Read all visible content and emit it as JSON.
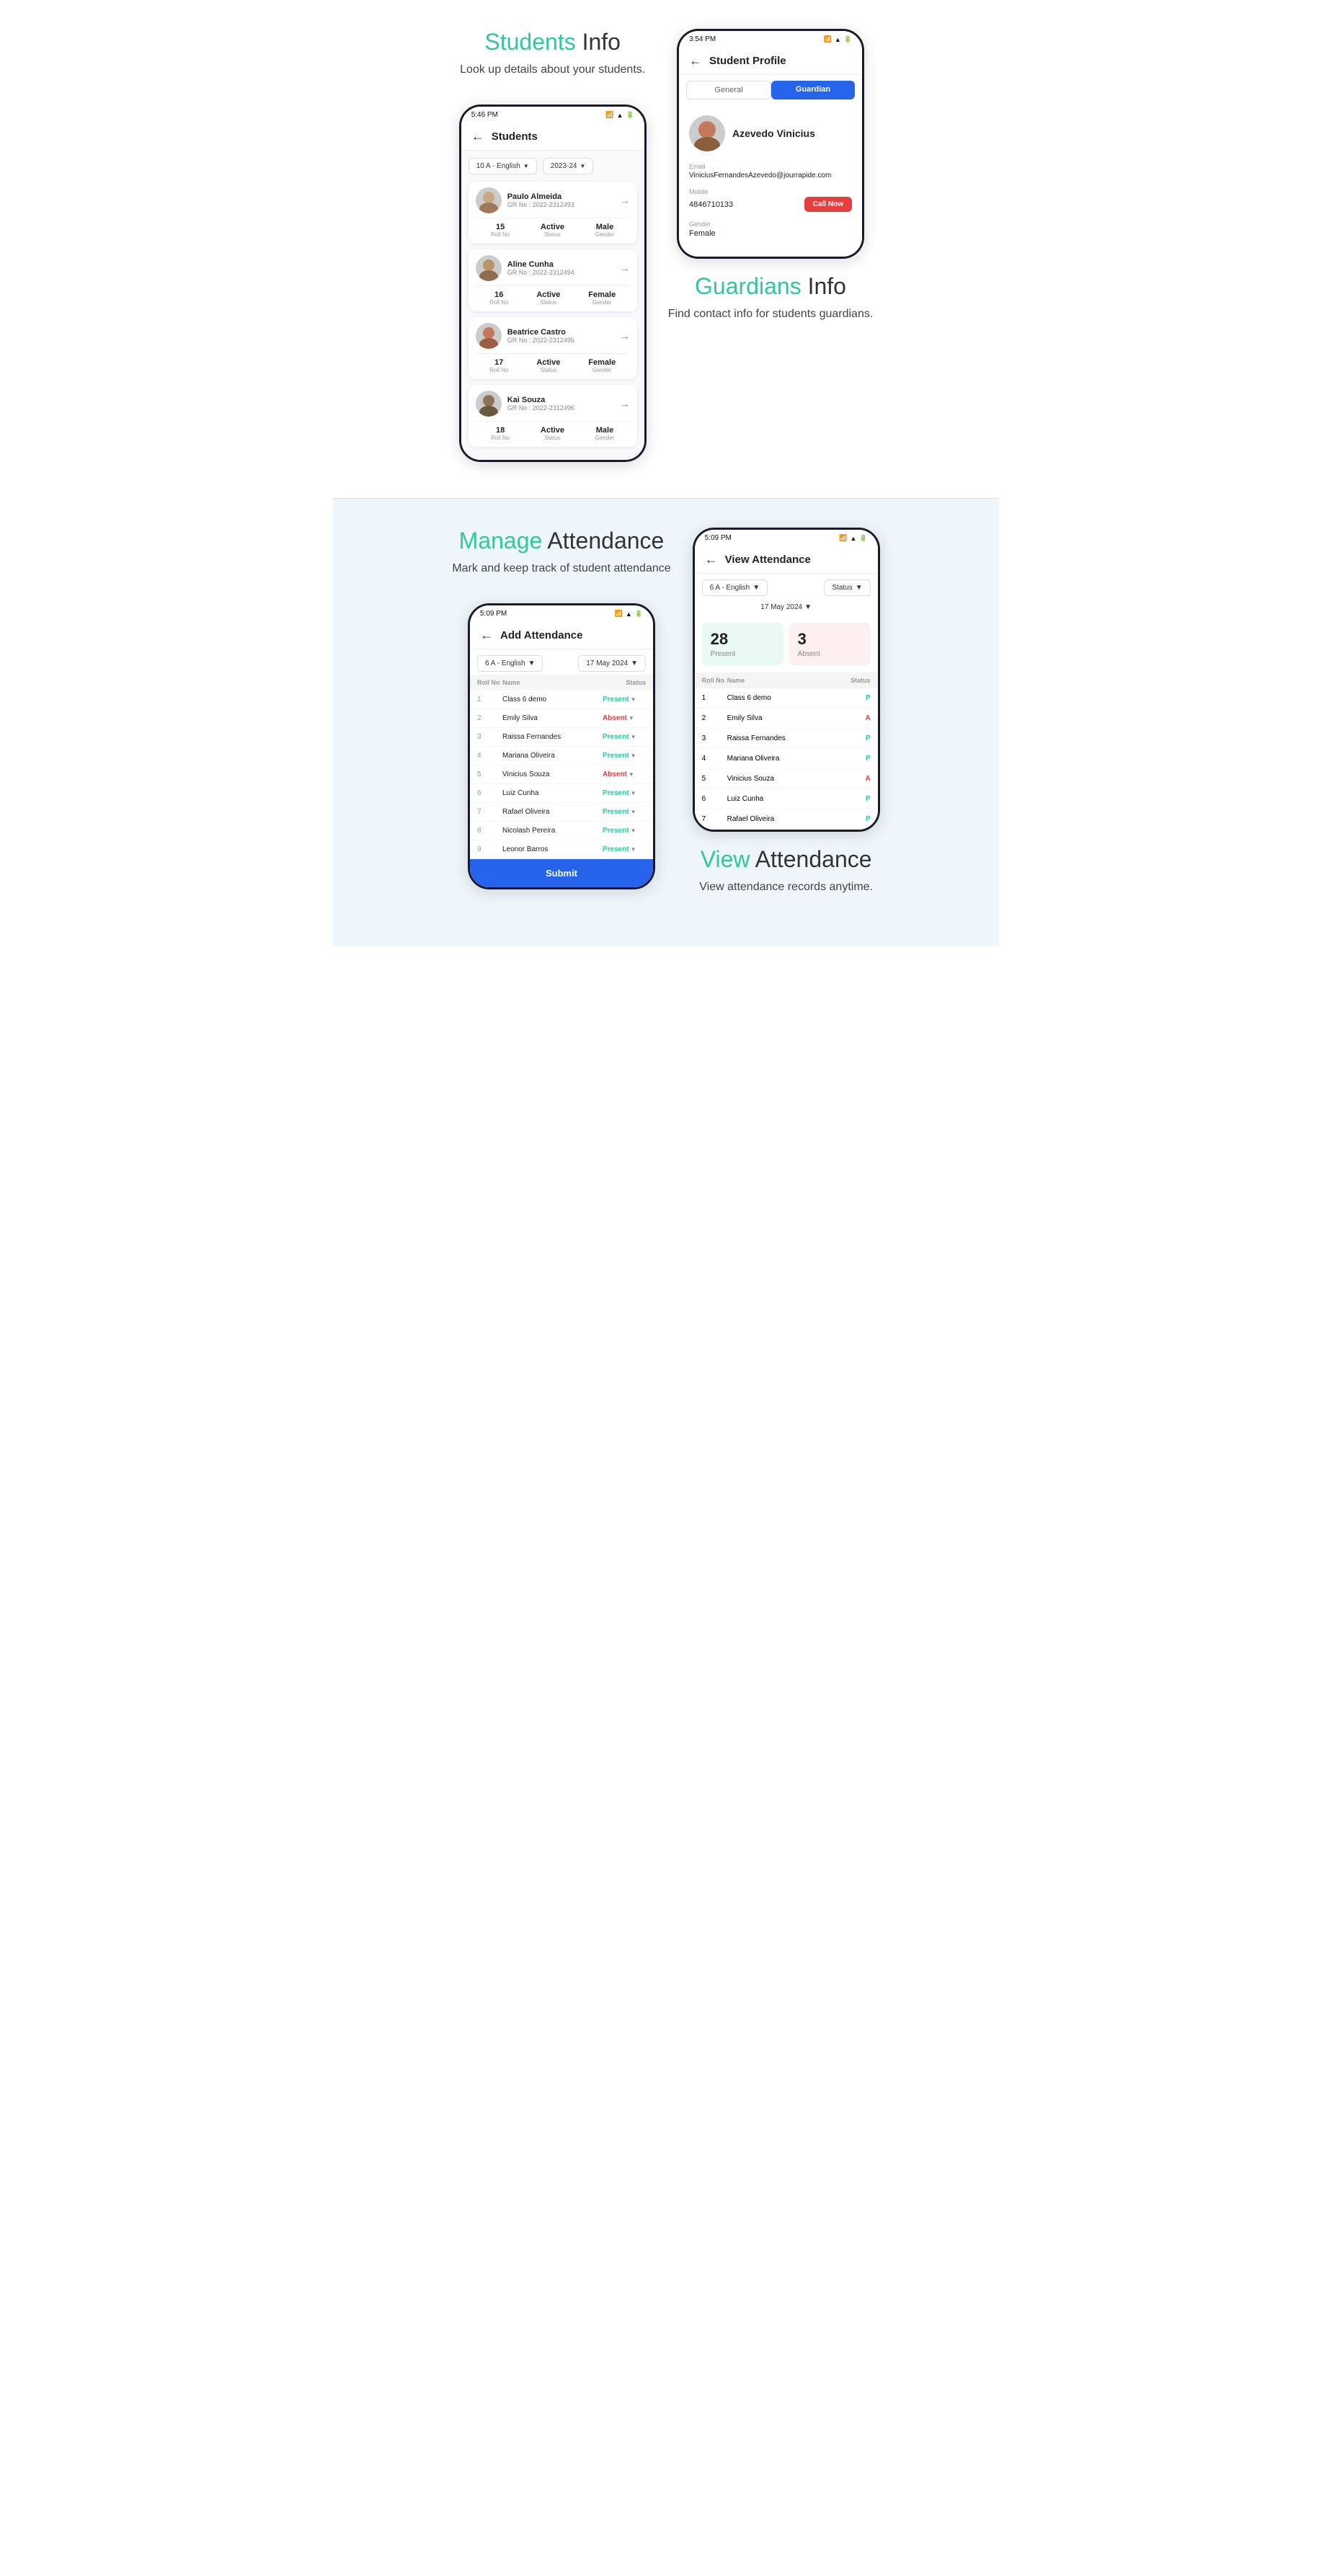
{
  "section1": {
    "title_green": "Students",
    "title_rest": " Info",
    "subtitle": "Look up details about your students.",
    "students_phone": {
      "status_bar_time": "5:46 PM",
      "header_title": "Students",
      "filter_class": "10 A - English",
      "filter_year": "2023-24",
      "students": [
        {
          "name": "Paulo Almeida",
          "gr": "GR No : 2022-2312493",
          "roll": "15",
          "status": "Active",
          "gender": "Male",
          "avatar_color": "#c8a882"
        },
        {
          "name": "Aline Cunha",
          "gr": "GR No : 2022-2312494",
          "roll": "16",
          "status": "Active",
          "gender": "Female",
          "avatar_color": "#b8956a"
        },
        {
          "name": "Beatrice Castro",
          "gr": "GR No : 2022-2312495",
          "roll": "17",
          "status": "Active",
          "gender": "Female",
          "avatar_color": "#c47a5a"
        },
        {
          "name": "Kai Souza",
          "gr": "GR No : 2022-2312496",
          "roll": "18",
          "status": "Active",
          "gender": "Male",
          "avatar_color": "#8b7355"
        }
      ]
    },
    "profile_phone": {
      "status_bar_time": "3:54 PM",
      "header_title": "Student Profile",
      "tab_general": "General",
      "tab_guardian": "Guardian",
      "profile_name": "Azevedo Vinicius",
      "email_label": "Email",
      "email_value": "ViniciusFernandesAzevedo@jourrapide.com",
      "mobile_label": "Mobile",
      "mobile_value": "4846710133",
      "gender_label": "Gender",
      "gender_value": "Female",
      "call_btn": "Call Now"
    }
  },
  "section1_guardians": {
    "title_green": "Guardians",
    "title_rest": " Info",
    "subtitle": "Find contact info for students guardians."
  },
  "section2": {
    "title_green": "Manage",
    "title_rest": " Attendance",
    "subtitle": "Mark and keep track of  student attendance",
    "add_phone": {
      "status_bar_time": "5:09 PM",
      "header_title": "Add Attendance",
      "filter_class": "6 A - English",
      "filter_date": "17 May 2024",
      "table_headers": [
        "Roll No",
        "Name",
        "Status"
      ],
      "rows": [
        {
          "roll": "1",
          "name": "Class 6 demo",
          "status": "Present",
          "absent": false
        },
        {
          "roll": "2",
          "name": "Emily Silva",
          "status": "Absent",
          "absent": true
        },
        {
          "roll": "3",
          "name": "Raissa Fernandes",
          "status": "Present",
          "absent": false
        },
        {
          "roll": "4",
          "name": "Mariana Oliveira",
          "status": "Present",
          "absent": false
        },
        {
          "roll": "5",
          "name": "Vinicius Souza",
          "status": "Absent",
          "absent": true
        },
        {
          "roll": "6",
          "name": "Luiz Cunha",
          "status": "Present",
          "absent": false
        },
        {
          "roll": "7",
          "name": "Rafael Oliveira",
          "status": "Present",
          "absent": false
        },
        {
          "roll": "8",
          "name": "Nicolash Pereira",
          "status": "Present",
          "absent": false
        },
        {
          "roll": "9",
          "name": "Leonor Barros",
          "status": "Present",
          "absent": false
        }
      ],
      "submit_btn": "Submit"
    },
    "view_phone": {
      "status_bar_time": "5:09 PM",
      "header_title": "View Attendance",
      "filter_class": "6 A - English",
      "filter_status": "Status",
      "filter_date": "17 May 2024",
      "present_count": "28",
      "present_label": "Present",
      "absent_count": "3",
      "absent_label": "Absent",
      "table_headers": [
        "Roll No",
        "Name",
        "Status"
      ],
      "rows": [
        {
          "roll": "1",
          "name": "Class 6 demo",
          "status": "P",
          "absent": false
        },
        {
          "roll": "2",
          "name": "Emily Silva",
          "status": "A",
          "absent": true
        },
        {
          "roll": "3",
          "name": "Raissa Fernandes",
          "status": "P",
          "absent": false
        },
        {
          "roll": "4",
          "name": "Mariana Oliveira",
          "status": "P",
          "absent": false
        },
        {
          "roll": "5",
          "name": "Vinicius Souza",
          "status": "A",
          "absent": true
        },
        {
          "roll": "6",
          "name": "Luiz Cunha",
          "status": "P",
          "absent": false
        },
        {
          "roll": "7",
          "name": "Rafael Oliveira",
          "status": "P",
          "absent": false
        }
      ]
    },
    "title2_green": "View",
    "title2_rest": " Attendance",
    "subtitle2": "View attendance records anytime."
  }
}
